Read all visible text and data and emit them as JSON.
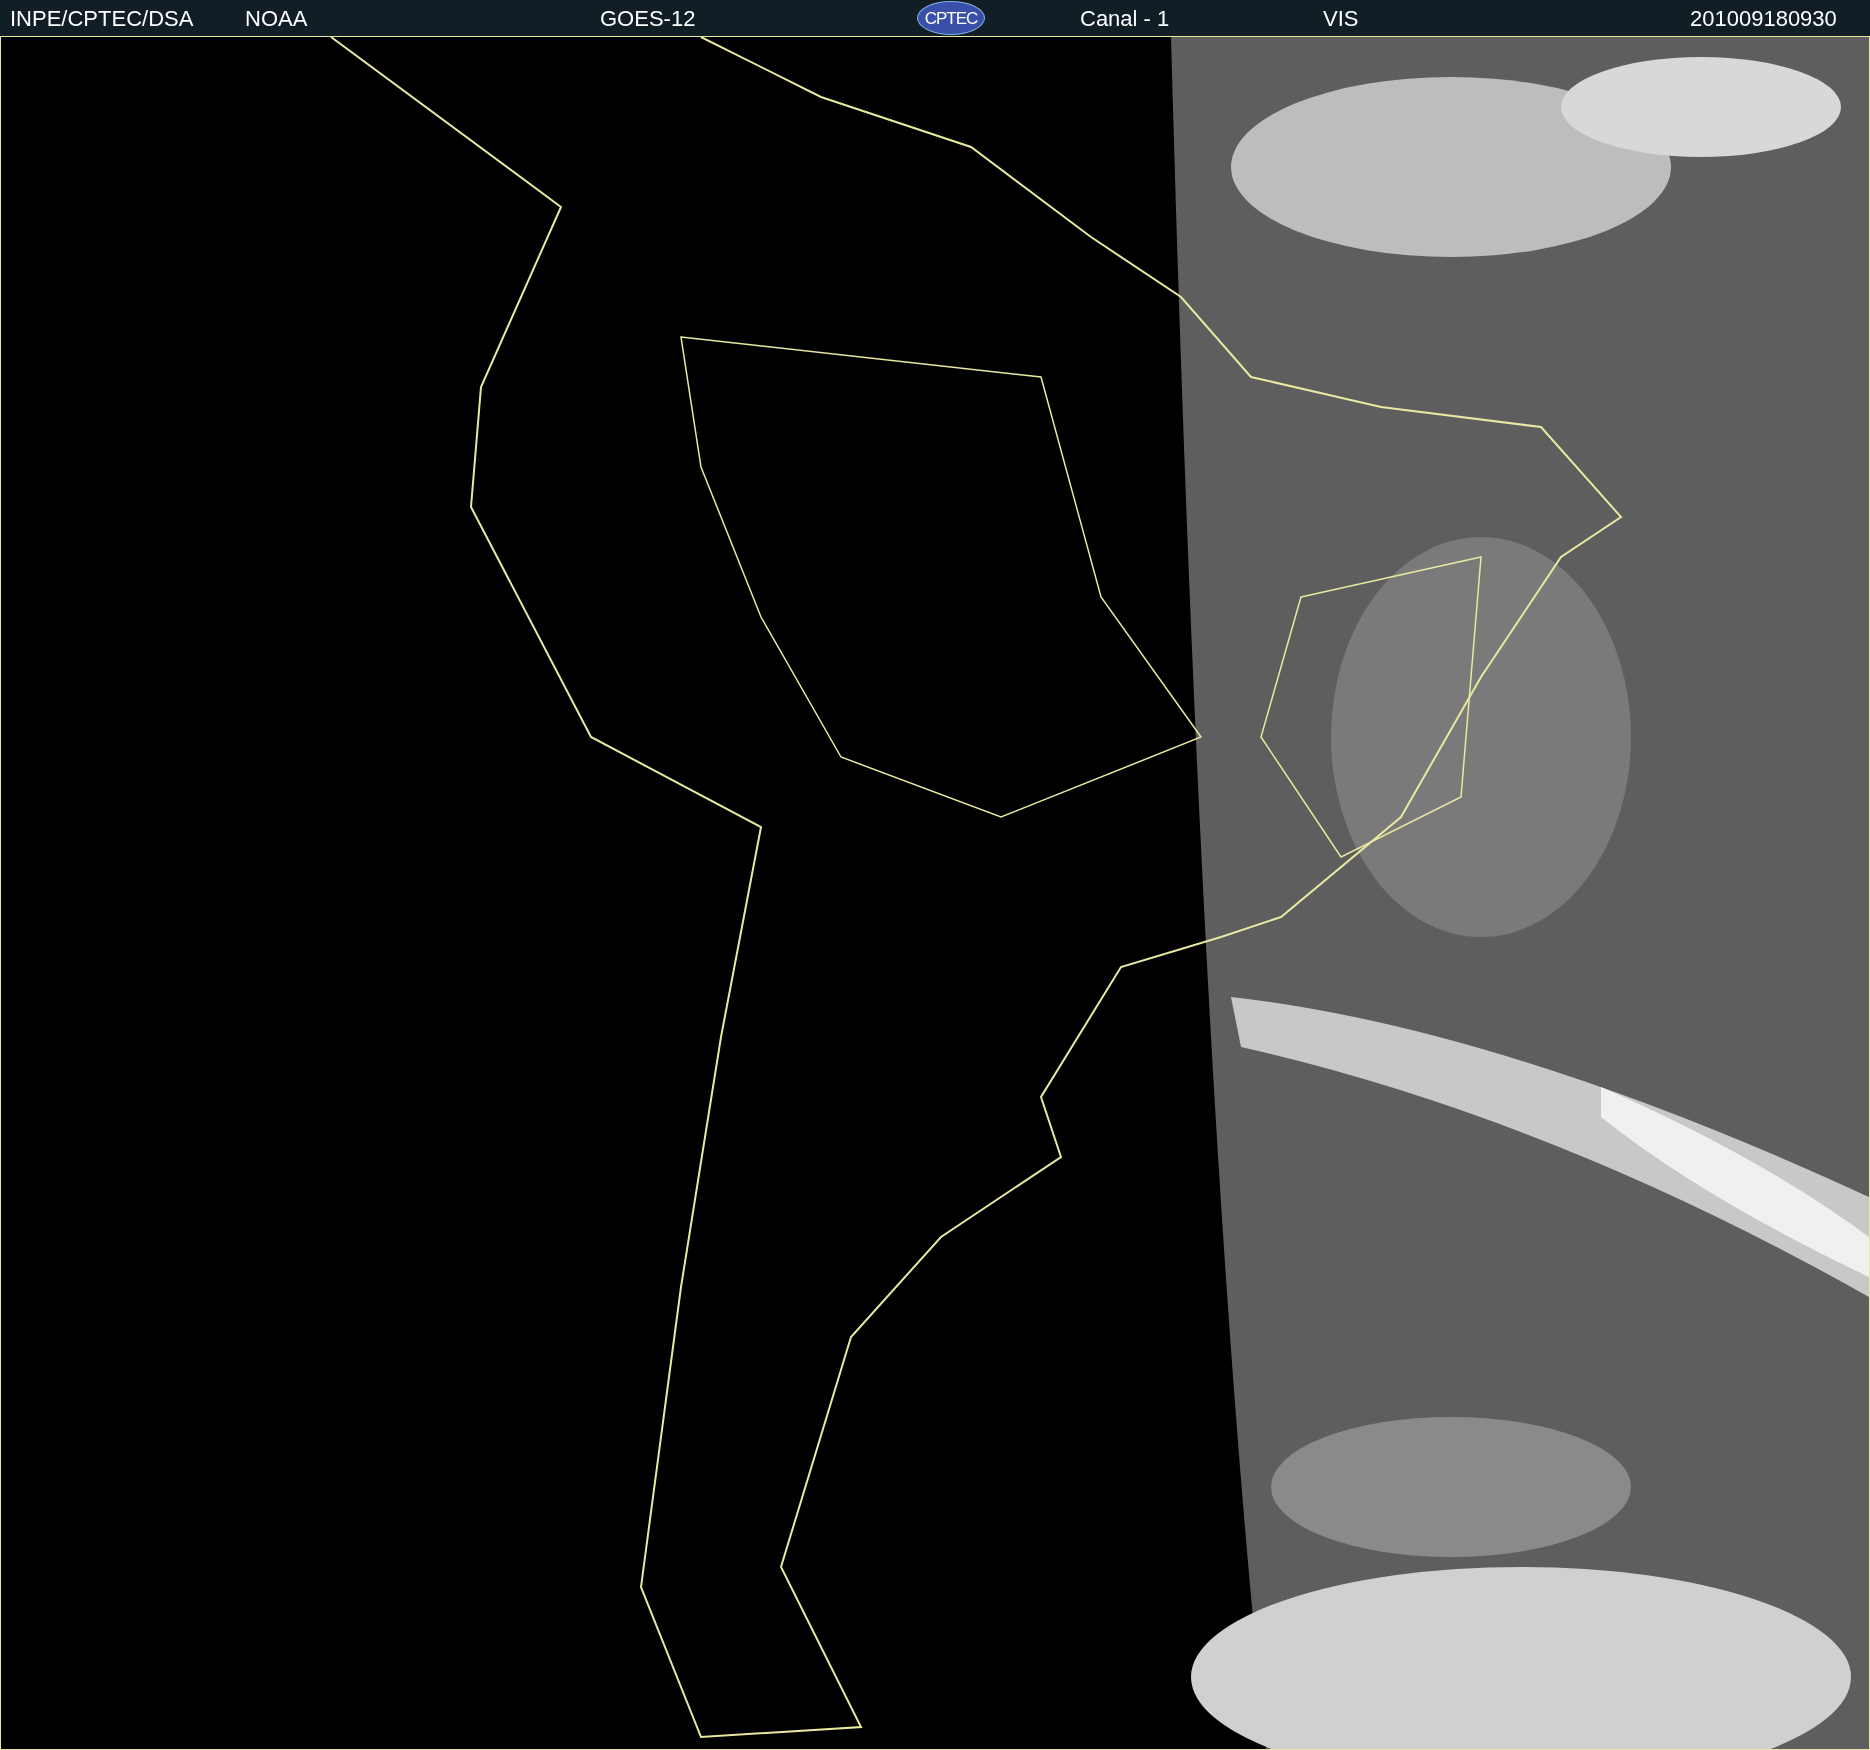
{
  "header": {
    "source": "INPE/CPTEC/DSA",
    "agency": "NOAA",
    "satellite": "GOES-12",
    "logo": "CPTEC",
    "channel": "Canal - 1",
    "band": "VIS",
    "timestamp": "201009180930"
  }
}
